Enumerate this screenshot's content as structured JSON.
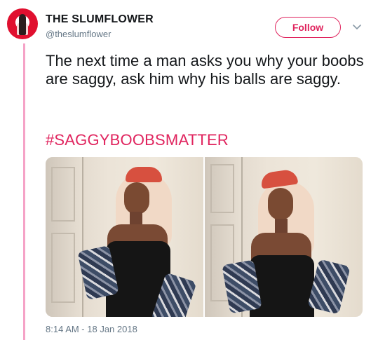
{
  "author": {
    "display_name": "THE SLUMFLOWER",
    "handle": "@theslumflower",
    "avatar_icon": "profile-photo"
  },
  "actions": {
    "follow_label": "Follow",
    "more_icon": "chevron-down-icon"
  },
  "tweet": {
    "text": "The next time a man asks you why your boobs are saggy, ask him why his balls are saggy.",
    "hashtag": "#SAGGYBOOBSMATTER",
    "timestamp": "8:14 AM - 18 Jan 2018"
  },
  "media": {
    "photos": [
      {
        "alt": "photo-1"
      },
      {
        "alt": "photo-2"
      }
    ]
  },
  "colors": {
    "accent": "#e0245e",
    "thread_line": "#f5a3c7",
    "text": "#14171a",
    "secondary_text": "#657786"
  }
}
